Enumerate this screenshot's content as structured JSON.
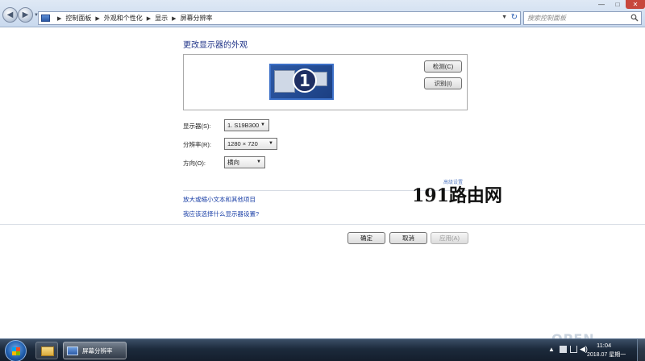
{
  "address_bar": {
    "breadcrumbs": [
      "控制面板",
      "外观和个性化",
      "显示",
      "屏幕分辨率"
    ],
    "search_placeholder": "搜索控制面板"
  },
  "page": {
    "title": "更改显示器的外观",
    "monitor_number": "1",
    "detect_button": "检测(C)",
    "identify_button": "识别(I)"
  },
  "fields": {
    "display_label": "显示器(S):",
    "display_value": "1. S19B300",
    "resolution_label": "分辨率(R):",
    "resolution_value": "1280 × 720",
    "orientation_label": "方向(O):",
    "orientation_value": "横向"
  },
  "links": {
    "advanced": "高级设置",
    "text_size": "放大或缩小文本和其他项目",
    "which_settings": "我应该选择什么显示器设置?"
  },
  "watermark": {
    "center_text": "191路由网",
    "corner_text": "OPEN"
  },
  "footer": {
    "ok": "确定",
    "cancel": "取消",
    "apply": "应用(A)"
  },
  "taskbar": {
    "window_title": "屏幕分辨率",
    "time": "11:04",
    "date": "2018.07 星期一"
  },
  "colors": {
    "title": "#1e3287",
    "link": "#1a3fa6",
    "close_button": "#c7463c"
  }
}
